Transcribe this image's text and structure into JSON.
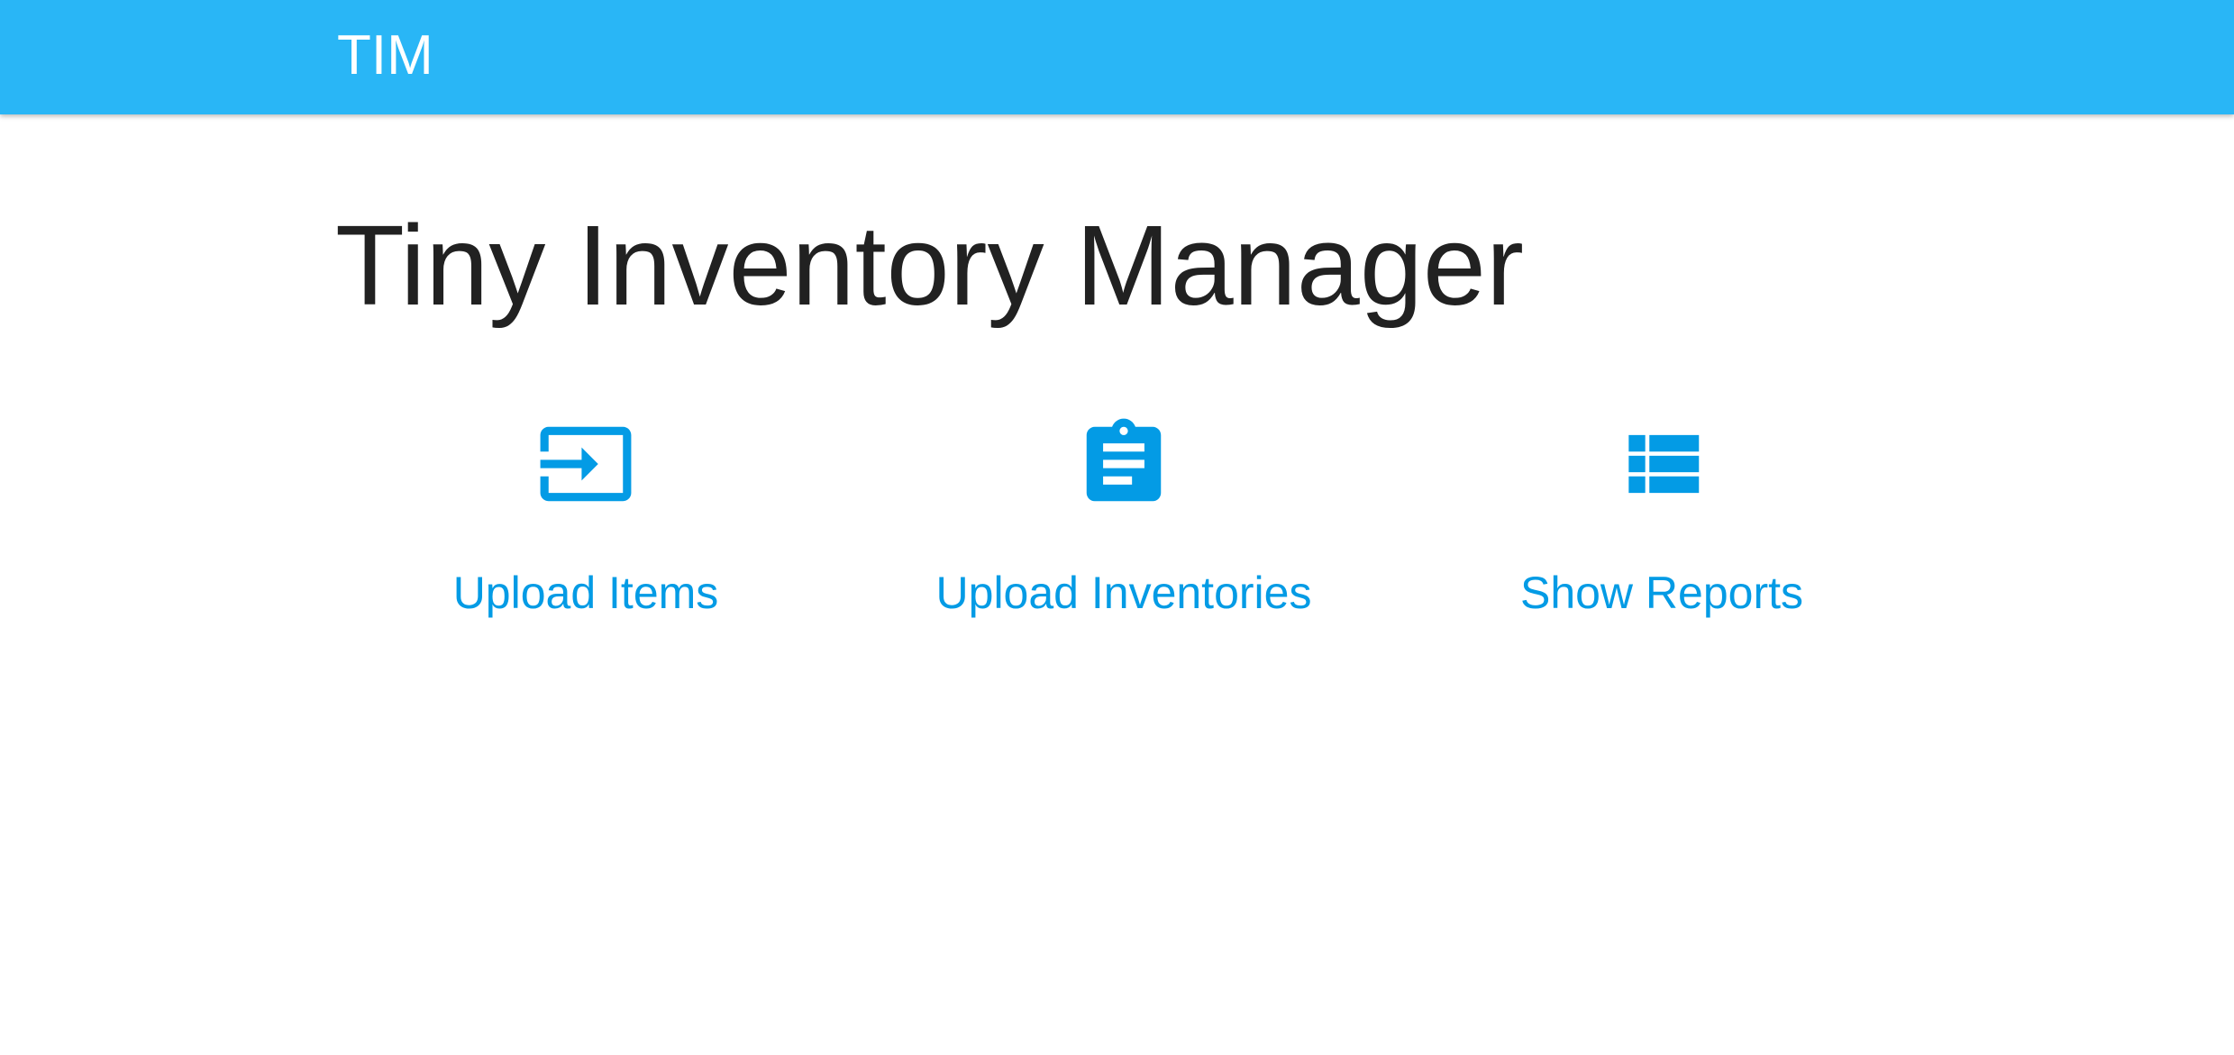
{
  "app_bar": {
    "brand": "TIM",
    "color": "#29b6f6"
  },
  "main": {
    "title": "Tiny Inventory Manager",
    "accent_color": "#039be5",
    "actions": [
      {
        "label": "Upload Items",
        "icon": "input-icon"
      },
      {
        "label": "Upload Inventories",
        "icon": "assignment-icon"
      },
      {
        "label": "Show Reports",
        "icon": "view-list-icon"
      }
    ]
  }
}
